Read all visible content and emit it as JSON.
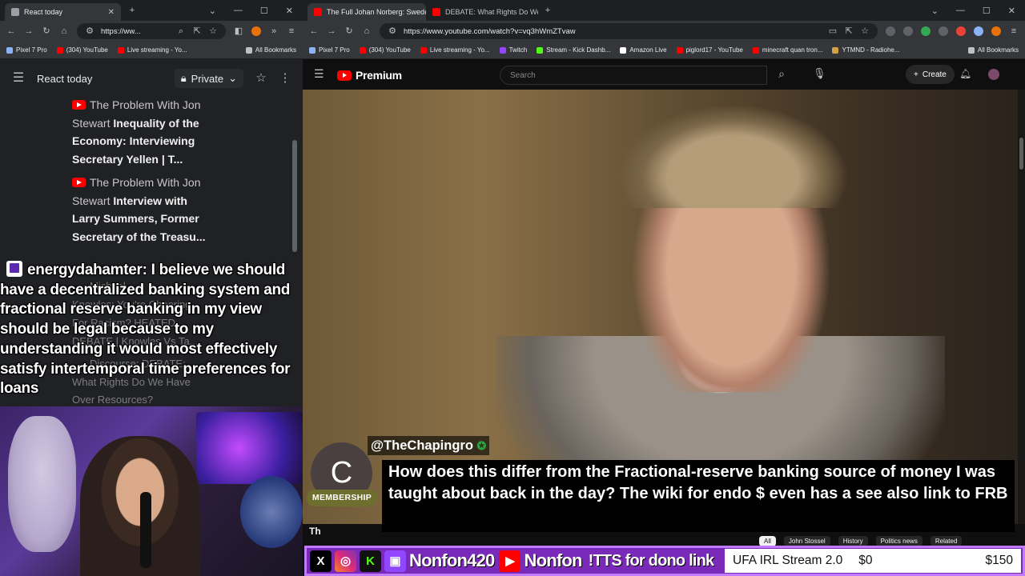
{
  "left_window": {
    "tab_title": "React today",
    "url": "https://ww...",
    "bookmarks": [
      {
        "label": "Pixel 7 Pro",
        "color": "#8ab4f8"
      },
      {
        "label": "(304) YouTube",
        "color": "#ff0000"
      },
      {
        "label": "Live streaming - Yo...",
        "color": "#ff0000"
      },
      {
        "label": "All Bookmarks",
        "color": "#bdc1c6"
      }
    ],
    "history_page": {
      "title": "React today",
      "privacy": "Private",
      "items": [
        {
          "channel": "The Problem With Jon",
          "channel2": "Stewart",
          "title_bold": "Inequality of the Economy: Interviewing Secretary Yellen | T..."
        },
        {
          "channel": "The Problem With Jon",
          "channel2": "Stewart",
          "title_bold": "Interview with Larry Summers, Former Secretary of the Treasu..."
        }
      ]
    }
  },
  "chat_overlay": {
    "username": "energydahamter:",
    "message": "I believe we should have a decentralized banking system and fractional reserve banking in my view should be legal because to my understanding it would most effectively satisfy intertemporal time preferences for loans",
    "ghost_lines": [
      "Michael",
      "Knowles: You're Cheering",
      "For Racism? HEATED",
      "DEBATE | Knowles Vs Ta...",
      "Discourse: DEBATE:",
      "What Rights Do We Have",
      "Over Resources?"
    ]
  },
  "right_window": {
    "tabs": [
      {
        "label": "The Full Johan Norberg: Swede",
        "active": true
      },
      {
        "label": "DEBATE: What Rights Do We H",
        "active": false
      }
    ],
    "url": "https://www.youtube.com/watch?v=vq3hWmZTvaw",
    "bookmarks": [
      {
        "label": "Pixel 7 Pro",
        "color": "#8ab4f8"
      },
      {
        "label": "(304) YouTube",
        "color": "#ff0000"
      },
      {
        "label": "Live streaming - Yo...",
        "color": "#ff0000"
      },
      {
        "label": "Twitch",
        "color": "#9146ff"
      },
      {
        "label": "Stream - Kick Dashb...",
        "color": "#53fc18"
      },
      {
        "label": "Amazon Live",
        "color": "#ffffff"
      },
      {
        "label": "piglord17 - YouTube",
        "color": "#ff0000"
      },
      {
        "label": "minecraft quan tron...",
        "color": "#ff0000"
      },
      {
        "label": "YTMND - Radiohe...",
        "color": "#d4a04a"
      },
      {
        "label": "All Bookmarks",
        "color": "#bdc1c6"
      }
    ]
  },
  "youtube": {
    "logo_text": "Premium",
    "search_placeholder": "Search",
    "create_label": "Create",
    "chips": [
      "All",
      "John Stossel",
      "History",
      "Politics news",
      "Related"
    ],
    "under_video_text": "Th"
  },
  "superchat": {
    "avatar_letter": "C",
    "badge": "MEMBERSHIP",
    "name": "@TheChapingro",
    "message": "How does this differ from the Fractional-reserve banking source of money I was taught about back in the day? The wiki for endo $ even has a see also link to FRB"
  },
  "stream_banner": {
    "handle_x": "X",
    "handle_kick": "K",
    "twitch_name": "Nonfon420",
    "youtube_name": "Nonfon",
    "tts_text": "!TTS for dono link",
    "goal_title": "UFA IRL Stream 2.0",
    "goal_current": "$0",
    "goal_target": "$150",
    "accent": "#7a2ab8"
  }
}
